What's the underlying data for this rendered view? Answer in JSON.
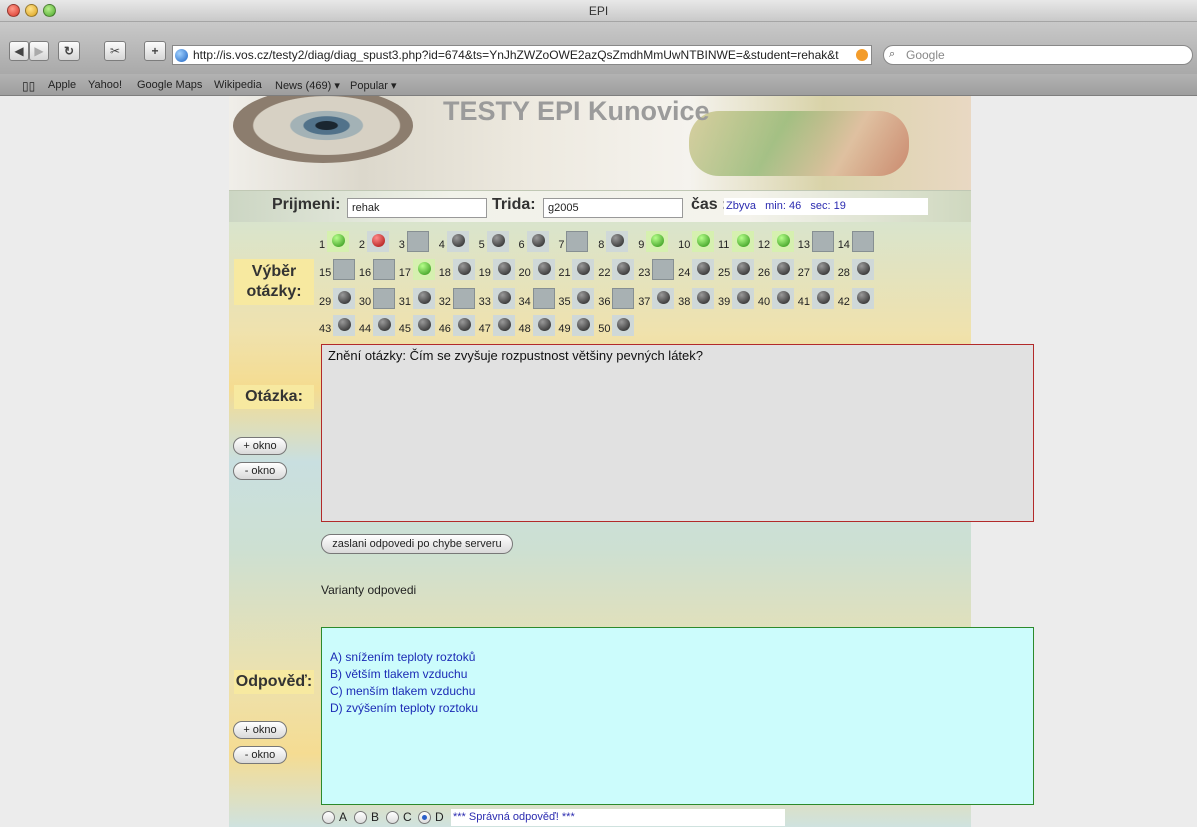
{
  "browser": {
    "window_title": "EPI",
    "url": "http://is.vos.cz/testy2/diag/diag_spust3.php?id=674&ts=YnJhZWZoOWE2azQsZmdhMmUwNTBINWE=&student=rehak&t",
    "search_placeholder": "Google",
    "bookmarks": [
      "Apple",
      "Yahoo!",
      "Google Maps",
      "Wikipedia",
      "News (469)",
      "Popular"
    ]
  },
  "banner": {
    "title": "TESTY EPI Kunovice"
  },
  "student": {
    "surname_label": "Prijmeni:",
    "surname_value": "rehak",
    "class_label": "Trida:",
    "class_value": "g2005",
    "time_label": "čas :",
    "time_value": "Zbyva   min: 46   sec: 19"
  },
  "selection": {
    "label_line1": "Výběr",
    "label_line2": "otázky:",
    "questions": [
      {
        "n": "1",
        "s": "green"
      },
      {
        "n": "2",
        "s": "red"
      },
      {
        "n": "3",
        "s": "empty"
      },
      {
        "n": "4",
        "s": "dark"
      },
      {
        "n": "5",
        "s": "dark"
      },
      {
        "n": "6",
        "s": "dark"
      },
      {
        "n": "7",
        "s": "empty"
      },
      {
        "n": "8",
        "s": "dark"
      },
      {
        "n": "9",
        "s": "green"
      },
      {
        "n": "10",
        "s": "green"
      },
      {
        "n": "11",
        "s": "green"
      },
      {
        "n": "12",
        "s": "green"
      },
      {
        "n": "13",
        "s": "empty"
      },
      {
        "n": "14",
        "s": "empty"
      },
      {
        "n": "15",
        "s": "empty"
      },
      {
        "n": "16",
        "s": "empty"
      },
      {
        "n": "17",
        "s": "green"
      },
      {
        "n": "18",
        "s": "dark"
      },
      {
        "n": "19",
        "s": "dark"
      },
      {
        "n": "20",
        "s": "dark"
      },
      {
        "n": "21",
        "s": "dark"
      },
      {
        "n": "22",
        "s": "dark"
      },
      {
        "n": "23",
        "s": "empty"
      },
      {
        "n": "24",
        "s": "dark"
      },
      {
        "n": "25",
        "s": "dark"
      },
      {
        "n": "26",
        "s": "dark"
      },
      {
        "n": "27",
        "s": "dark"
      },
      {
        "n": "28",
        "s": "dark"
      },
      {
        "n": "29",
        "s": "dark"
      },
      {
        "n": "30",
        "s": "empty"
      },
      {
        "n": "31",
        "s": "dark"
      },
      {
        "n": "32",
        "s": "empty"
      },
      {
        "n": "33",
        "s": "dark"
      },
      {
        "n": "34",
        "s": "empty"
      },
      {
        "n": "35",
        "s": "dark"
      },
      {
        "n": "36",
        "s": "empty"
      },
      {
        "n": "37",
        "s": "dark"
      },
      {
        "n": "38",
        "s": "dark"
      },
      {
        "n": "39",
        "s": "dark"
      },
      {
        "n": "40",
        "s": "dark"
      },
      {
        "n": "41",
        "s": "dark"
      },
      {
        "n": "42",
        "s": "dark"
      },
      {
        "n": "43",
        "s": "dark"
      },
      {
        "n": "44",
        "s": "dark"
      },
      {
        "n": "45",
        "s": "dark"
      },
      {
        "n": "46",
        "s": "dark"
      },
      {
        "n": "47",
        "s": "dark"
      },
      {
        "n": "48",
        "s": "dark"
      },
      {
        "n": "49",
        "s": "dark"
      },
      {
        "n": "50",
        "s": "dark"
      }
    ]
  },
  "question": {
    "label": "Otázka:",
    "text": "Znění otázky: Čím se zvyšuje rozpustnost většiny pevných látek?",
    "plus_window": "+ okno",
    "minus_window": "- okno",
    "error_button": "zaslani odpovedi po chybe serveru"
  },
  "answers": {
    "title": "Varianty odpovedi",
    "label": "Odpověď:",
    "plus_window": "+ okno",
    "minus_window": "- okno",
    "options": [
      "A)  snížením teploty roztoků",
      "B)  větším tlakem vzduchu",
      "C)  menším tlakem vzduchu",
      "D)  zvýšením teploty roztoku"
    ],
    "radio_labels": [
      "A",
      "B",
      "C",
      "D"
    ],
    "selected": "D",
    "result_text": "*** Správná odpověď! ***"
  },
  "colors": {
    "answered_correct": "#2a8f13",
    "answered_wrong": "#a50b0b",
    "answer_text": "#1b2bb5",
    "question_border": "#b22a2a",
    "answer_border": "#2c8a2c"
  }
}
